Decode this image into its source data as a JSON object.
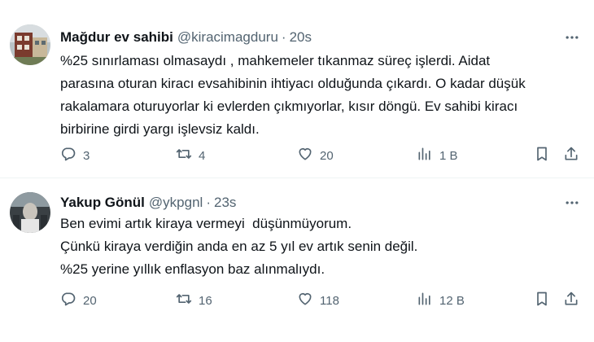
{
  "tweets": [
    {
      "name": "Mağdur ev sahibi",
      "handle": "@kiracimagduru",
      "separator": "·",
      "time": "20s",
      "lines": [
        "%25 sınırlaması olmasaydı , mahkemeler tıkanmaz süreç işlerdi. Aidat",
        "parasına oturan kiracı evsahibinin ihtiyacı olduğunda çıkardı. O kadar düşük",
        "rakalamara oturuyorlar ki evlerden çıkmıyorlar, kısır döngü. Ev sahibi kiracı",
        "birbirine girdi yargı işlevsiz kaldı."
      ],
      "replies": "3",
      "retweets": "4",
      "likes": "20",
      "views": "1 B"
    },
    {
      "name": "Yakup Gönül",
      "handle": "@ykpgnl",
      "separator": "·",
      "time": "23s",
      "lines": [
        "Ben evimi artık kiraya vermeyi  düşünmüyorum.",
        "Çünkü kiraya verdiğin anda en az 5 yıl ev artık senin değil.",
        "%25 yerine yıllık enflasyon baz alınmalıydı."
      ],
      "replies": "20",
      "retweets": "16",
      "likes": "118",
      "views": "12 B"
    }
  ],
  "icons": [
    "reply-icon",
    "retweet-icon",
    "like-icon",
    "views-icon",
    "bookmark-icon",
    "share-icon",
    "more-icon"
  ],
  "colors": {
    "text": "#0f1419",
    "secondary": "#536471",
    "divider": "#eff3f4"
  }
}
